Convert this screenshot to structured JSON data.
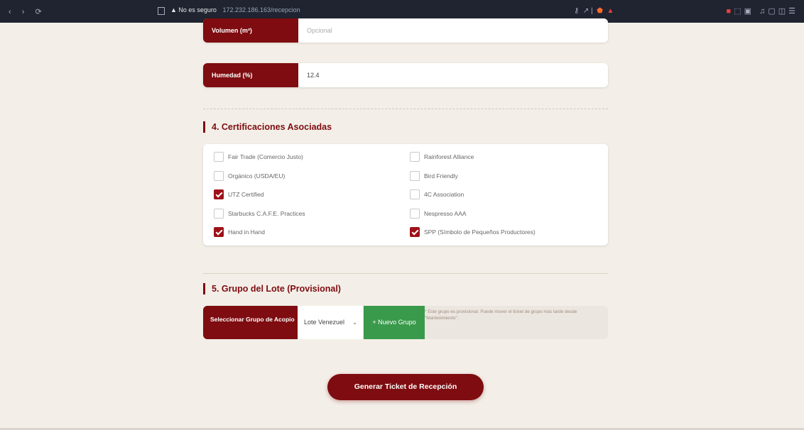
{
  "browser": {
    "nav_icons": "‹ › ⟳",
    "security_label": "▲ No es seguro",
    "url": "172.232.186.163/recepcion"
  },
  "form": {
    "volumen": {
      "label": "Volumen (m³)",
      "placeholder": "Opcional"
    },
    "humedad": {
      "label": "Humedad (%)",
      "value": "12.4"
    }
  },
  "certifications": {
    "title": "4. Certificaciones Asociadas",
    "items": [
      {
        "label": "Fair Trade (Comercio Justo)",
        "checked": false
      },
      {
        "label": "Rainforest Alliance",
        "checked": false
      },
      {
        "label": "Orgánico (USDA/EU)",
        "checked": false
      },
      {
        "label": "Bird Friendly",
        "checked": false
      },
      {
        "label": "UTZ Certified",
        "checked": true
      },
      {
        "label": "4C Association",
        "checked": false
      },
      {
        "label": "Starbucks C.A.F.E. Practices",
        "checked": false
      },
      {
        "label": "Nespresso AAA",
        "checked": false
      },
      {
        "label": "Hand in Hand",
        "checked": true
      },
      {
        "label": "SPP (Símbolo de Pequeños Productores)",
        "checked": true
      }
    ]
  },
  "group": {
    "title": "5. Grupo del Lote (Provisional)",
    "select_label": "Seleccionar Grupo de Acopio",
    "selected": "Lote Venezuel",
    "new_group_button": "+ Nuevo Grupo",
    "note": "* Este grupo es provisional. Puede mover el ticket de grupo más tarde desde \"Mantenimiento\"."
  },
  "submit_label": "Generar Ticket de Recepción",
  "colors": {
    "primary": "#7e0c10",
    "checkbox": "#9e1118",
    "success": "#3a9a4b",
    "background": "#f3efe8"
  }
}
